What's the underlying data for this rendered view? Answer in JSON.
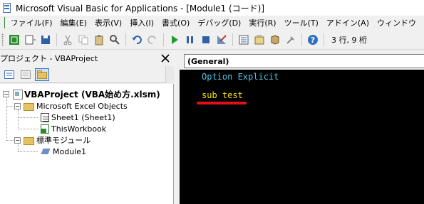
{
  "window": {
    "title": "Microsoft Visual Basic for Applications - [Module1 (コード)]"
  },
  "menu": {
    "items": [
      "ファイル(F)",
      "編集(E)",
      "表示(V)",
      "挿入(I)",
      "書式(O)",
      "デバッグ(D)",
      "実行(R)",
      "ツール(T)",
      "アドイン(A)",
      "ウィンドウ"
    ]
  },
  "toolbar": {
    "cursor_position": "3 行, 9 桁"
  },
  "project": {
    "title": "プロジェクト - VBAProject",
    "root": "VBAProject (VBA始め方.xlsm)",
    "excel_objects_folder": "Microsoft Excel Objects",
    "sheet1": "Sheet1 (Sheet1)",
    "workbook": "ThisWorkbook",
    "modules_folder": "標準モジュール",
    "module1": "Module1"
  },
  "code": {
    "object_combo": "(General)",
    "lines": [
      "Option Explicit",
      "sub test"
    ]
  },
  "colors": {
    "keyword": "#4fc3e8",
    "user_text": "#f5e500",
    "highlight_underline": "#e0101a"
  }
}
